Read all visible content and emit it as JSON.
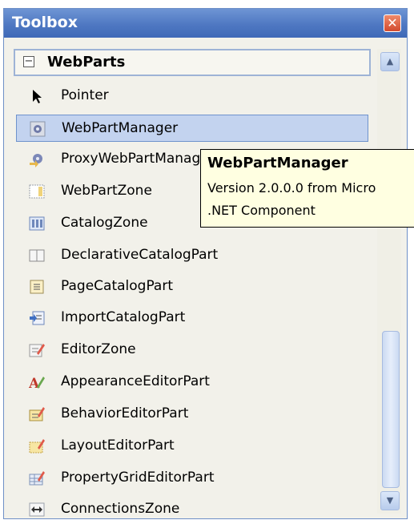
{
  "window": {
    "title": "Toolbox",
    "close_symbol": "✕"
  },
  "category": {
    "name": "WebParts",
    "expander_symbol": "−"
  },
  "items": [
    {
      "label": "Pointer",
      "icon": "pointer-icon"
    },
    {
      "label": "WebPartManager",
      "icon": "webpart-manager-icon",
      "selected": true
    },
    {
      "label": "ProxyWebPartManager",
      "icon": "proxy-webpart-manager-icon"
    },
    {
      "label": "WebPartZone",
      "icon": "webpart-zone-icon"
    },
    {
      "label": "CatalogZone",
      "icon": "catalog-zone-icon"
    },
    {
      "label": "DeclarativeCatalogPart",
      "icon": "declarative-catalog-part-icon"
    },
    {
      "label": "PageCatalogPart",
      "icon": "page-catalog-part-icon"
    },
    {
      "label": "ImportCatalogPart",
      "icon": "import-catalog-part-icon"
    },
    {
      "label": "EditorZone",
      "icon": "editor-zone-icon"
    },
    {
      "label": "AppearanceEditorPart",
      "icon": "appearance-editor-part-icon"
    },
    {
      "label": "BehaviorEditorPart",
      "icon": "behavior-editor-part-icon"
    },
    {
      "label": "LayoutEditorPart",
      "icon": "layout-editor-part-icon"
    },
    {
      "label": "PropertyGridEditorPart",
      "icon": "property-grid-editor-part-icon"
    },
    {
      "label": "ConnectionsZone",
      "icon": "connections-zone-icon"
    }
  ],
  "tooltip": {
    "title": "WebPartManager",
    "line1": "Version 2.0.0.0 from Micro",
    "line2": ".NET Component"
  },
  "scrollbar": {
    "up_symbol": "▲",
    "down_symbol": "▼"
  },
  "colors": {
    "titlebar": "#4f78c2",
    "selection": "#c3d3ef",
    "tooltip": "#ffffe1",
    "panel": "#f2f1ea"
  }
}
